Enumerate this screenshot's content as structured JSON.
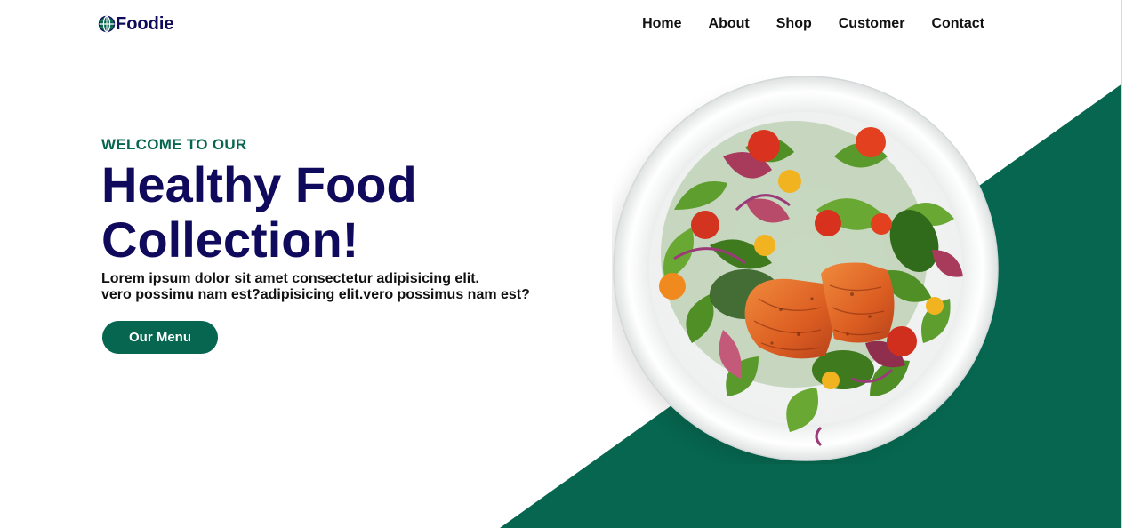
{
  "brand": {
    "name": "Foodie",
    "icon": "globe-icon",
    "title_color": "#0f0a5c",
    "accent": "#07664f"
  },
  "nav": {
    "items": [
      "Home",
      "About",
      "Shop",
      "Customer",
      "Contact"
    ]
  },
  "hero": {
    "eyebrow": "WELCOME TO OUR",
    "headline_line1": "Healthy Food",
    "headline_line2": "Collection!",
    "desc_line1": "Lorem ipsum dolor sit amet consectetur adipisicing elit.",
    "desc_line2": "vero possimu nam est?adipisicing elit.vero possimus nam est?",
    "cta_label": "Our Menu"
  },
  "image": {
    "subject": "salad-plate-with-salmon"
  }
}
